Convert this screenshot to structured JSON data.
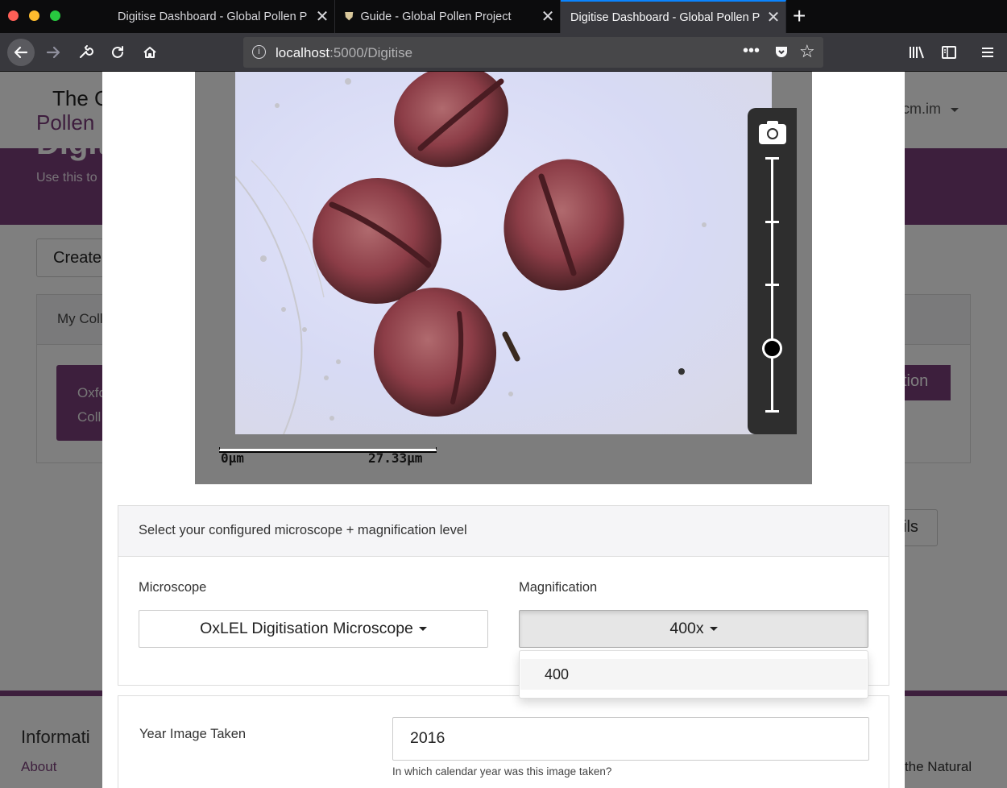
{
  "browser": {
    "tabs": [
      {
        "title": "Digitise Dashboard - Global Pollen P"
      },
      {
        "title": "Guide - Global Pollen Project"
      },
      {
        "title": "Digitise Dashboard - Global Pollen P"
      }
    ],
    "url_host": "localhost",
    "url_path": ":5000/Digitise"
  },
  "background": {
    "brand_line1": "The G",
    "brand_line2": "Pollen",
    "user": "cm.im",
    "hero_title": "Digit",
    "hero_subtitle": "Use this to",
    "create_button": "Create",
    "panel_header": "My Coll",
    "card_line1": "Oxfo",
    "card_line2": "Coll",
    "right_button": "tion",
    "details_button": "ils",
    "footer_title": "Informati",
    "footer_link": "About",
    "footer_right": "ia the Natural"
  },
  "modal": {
    "scale": {
      "start": "0µm",
      "end": "27.33µm"
    },
    "zoom_level": 0.75,
    "microscope_section": {
      "header": "Select your configured microscope + magnification level",
      "microscope_label": "Microscope",
      "microscope_value": "OxLEL Digitisation Microscope",
      "magnification_label": "Magnification",
      "magnification_value": "400x",
      "magnification_options": [
        "400"
      ]
    },
    "year_section": {
      "label": "Year Image Taken",
      "value": "2016",
      "help": "In which calendar year was this image taken?"
    }
  }
}
